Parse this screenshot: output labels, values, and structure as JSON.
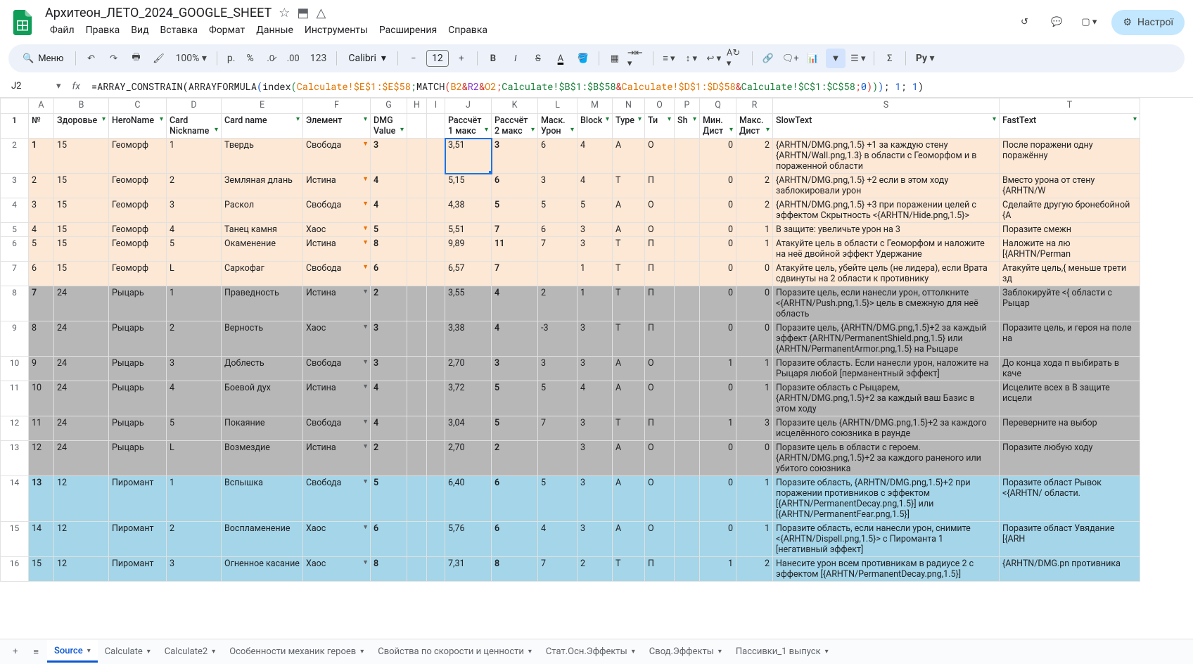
{
  "doc": {
    "title": "Архитеон_ЛЕТО_2024_GOOGLE_SHEET"
  },
  "menubar": [
    "Файл",
    "Правка",
    "Вид",
    "Вставка",
    "Формат",
    "Данные",
    "Инструменты",
    "Расширения",
    "Справка"
  ],
  "header_right": {
    "settings": "Настрої"
  },
  "toolbar": {
    "search_label": "Меню",
    "zoom": "100%",
    "currency": "р.",
    "percent": "%",
    "digits": "123",
    "font": "Calibri",
    "fontsize": "12"
  },
  "namebox": "J2",
  "formula": {
    "parts": [
      {
        "t": "=",
        "c": "fn-black"
      },
      {
        "t": "ARRAY_CONSTRAIN",
        "c": "fn-black"
      },
      {
        "t": "(",
        "c": "fn-black"
      },
      {
        "t": "ARRAYFORMULA",
        "c": "fn-black"
      },
      {
        "t": "(",
        "c": "fn-blue"
      },
      {
        "t": "index",
        "c": "fn-black"
      },
      {
        "t": "(",
        "c": "fn-green"
      },
      {
        "t": "Calculate!$E$1:$E$58",
        "c": "fn-orange"
      },
      {
        "t": ";",
        "c": "fn-green"
      },
      {
        "t": "MATCH",
        "c": "fn-black"
      },
      {
        "t": "(",
        "c": "fn-red"
      },
      {
        "t": "B2",
        "c": "fn-orange"
      },
      {
        "t": "&",
        "c": "fn-red"
      },
      {
        "t": "R2",
        "c": "fn-purple"
      },
      {
        "t": "&",
        "c": "fn-red"
      },
      {
        "t": "O2",
        "c": "fn-orange"
      },
      {
        "t": ";",
        "c": "fn-red"
      },
      {
        "t": "Calculate!$B$1:$B$58",
        "c": "fn-green"
      },
      {
        "t": "&",
        "c": "fn-red"
      },
      {
        "t": "Calculate!$D$1:$D$58",
        "c": "fn-orange"
      },
      {
        "t": "&",
        "c": "fn-red"
      },
      {
        "t": "Calculate!$C$1:$C$58",
        "c": "fn-green"
      },
      {
        "t": ";",
        "c": "fn-red"
      },
      {
        "t": "0",
        "c": "fn-blue"
      },
      {
        "t": ")",
        "c": "fn-red"
      },
      {
        "t": ")",
        "c": "fn-green"
      },
      {
        "t": ")",
        "c": "fn-blue"
      },
      {
        "t": "; ",
        "c": "fn-black"
      },
      {
        "t": "1",
        "c": "fn-blue"
      },
      {
        "t": "; ",
        "c": "fn-black"
      },
      {
        "t": "1",
        "c": "fn-blue"
      },
      {
        "t": ")",
        "c": "fn-black"
      }
    ]
  },
  "columns": [
    "A",
    "B",
    "C",
    "D",
    "E",
    "F",
    "G",
    "H",
    "I",
    "J",
    "K",
    "L",
    "M",
    "N",
    "O",
    "P",
    "Q",
    "R",
    "S",
    "T"
  ],
  "headers": {
    "A": "№",
    "B": "Здоровье",
    "C": "HeroName",
    "D": "Card Nickname",
    "E": "Card name",
    "F": "Элемент",
    "G": "DMG Value",
    "H": "",
    "I": "",
    "J": "Рассчёт 1 макс",
    "K": "Рассчёт 2 макс",
    "L": "Маск. Урон",
    "M": "Block",
    "N": "Type",
    "O": "Ти",
    "P": "Sh",
    "Q": "Мин. Дист",
    "R": "Макс. Дист",
    "S": "SlowText",
    "T": "FastText"
  },
  "rows": [
    {
      "n": "1",
      "bg": "bg-cream",
      "bold": true,
      "A": "1",
      "B": "15",
      "C": "Геоморф",
      "D": "1",
      "E": "Твердь",
      "F": "Свобода",
      "Fdd": "o",
      "G": "3",
      "J": "3,51",
      "K": "3",
      "L": "6",
      "M": "4",
      "N": "А",
      "O": "О",
      "Q": "0",
      "R": "2",
      "S": "{ARHTN/DMG.png,1.5} +1 за каждую стену {ARHTN/Wall.png,1.3} в области с Геоморфом и в пораженной области",
      "T": "После поражени одну поражённу"
    },
    {
      "n": "2",
      "bg": "bg-cream",
      "A": "2",
      "B": "15",
      "C": "Геоморф",
      "D": "2",
      "E": "Земляная длань",
      "F": "Истина",
      "Fdd": "o",
      "G": "4",
      "J": "5,15",
      "K": "6",
      "L": "3",
      "M": "4",
      "N": "Т",
      "O": "П",
      "Q": "0",
      "R": "2",
      "S": "{ARHTN/DMG.png,1.5} +2 если в этом ходу заблокировали урон",
      "T": "Вместо урона от стену {ARHTN/W"
    },
    {
      "n": "3",
      "bg": "bg-cream",
      "A": "3",
      "B": "15",
      "C": "Геоморф",
      "D": "3",
      "E": "Раскол",
      "F": "Свобода",
      "Fdd": "o",
      "G": "4",
      "J": "4,38",
      "K": "5",
      "L": "5",
      "M": "5",
      "N": "А",
      "O": "О",
      "Q": "0",
      "R": "2",
      "S": "{ARHTN/DMG.png,1.5} +3 при поражении целей с эффектом Скрытность <{ARHTN/Hide.png,1.5}>",
      "T": "Сделайте другую бронебойной {А"
    },
    {
      "n": "4",
      "bg": "bg-cream",
      "A": "4",
      "B": "15",
      "C": "Геоморф",
      "D": "4",
      "E": "Танец камня",
      "F": "Хаос",
      "Fdd": "o",
      "G": "5",
      "J": "5,51",
      "K": "7",
      "L": "6",
      "M": "3",
      "N": "А",
      "O": "О",
      "Q": "0",
      "R": "1",
      "S": "В защите: увеличьте урон на 3",
      "T": "Поразите смежн"
    },
    {
      "n": "5",
      "bg": "bg-cream",
      "A": "5",
      "B": "15",
      "C": "Геоморф",
      "D": "5",
      "E": "Окаменение",
      "F": "Истина",
      "Fdd": "o",
      "G": "8",
      "J": "9,89",
      "K": "11",
      "L": "7",
      "M": "3",
      "N": "Т",
      "O": "П",
      "Q": "0",
      "R": "1",
      "S": "Атакуйте цель в области с Геоморфом и наложите на неё двойной эффект Удержание",
      "T": "Наложите на лю [{ARHTN/Perman"
    },
    {
      "n": "6",
      "bg": "bg-cream",
      "A": "6",
      "B": "15",
      "C": "Геоморф",
      "D": "L",
      "E": "Саркофаг",
      "F": "Свобода",
      "Fdd": "o",
      "G": "6",
      "J": "6,57",
      "K": "7",
      "L": "",
      "M": "1",
      "N": "Т",
      "O": "П",
      "Q": "0",
      "R": "0",
      "S": "Атакуйте цель, убейте цель (не лидера), если Врата сдвинуты на 2 области к противнику",
      "T": "Атакуйте цель,{ меньше трети зд"
    },
    {
      "n": "7",
      "bg": "bg-gray",
      "bold": true,
      "A": "7",
      "B": "24",
      "C": "Рыцарь",
      "D": "1",
      "E": "Праведность",
      "F": "Истина",
      "Fdd": "b",
      "G": "2",
      "J": "3,55",
      "K": "4",
      "L": "2",
      "M": "1",
      "N": "Т",
      "O": "П",
      "Q": "0",
      "R": "0",
      "S": "Поразите цель, если нанесли урон, оттолкните <{ARHTN/Push.png,1.5}> цель в смежную для неё область",
      "T": "Заблокируйте <{ области с Рыцар"
    },
    {
      "n": "8",
      "bg": "bg-gray",
      "A": "8",
      "B": "24",
      "C": "Рыцарь",
      "D": "2",
      "E": "Верность",
      "F": "Хаос",
      "Fdd": "b",
      "G": "3",
      "J": "3,38",
      "K": "4",
      "L": "-3",
      "M": "3",
      "N": "Т",
      "O": "П",
      "Q": "0",
      "R": "0",
      "S": "Поразите цель, {ARHTN/DMG.png,1.5}+2 за каждый эффект {ARHTN/PermanentShield.png,1.5} или {ARHTN/PermanentArmor.png,1.5} на Рыцаре",
      "T": "Поразите цель, и героя на поле на"
    },
    {
      "n": "9",
      "bg": "bg-gray",
      "A": "9",
      "B": "24",
      "C": "Рыцарь",
      "D": "3",
      "E": "Доблесть",
      "F": "Свобода",
      "Fdd": "b",
      "G": "3",
      "J": "2,70",
      "K": "3",
      "L": "3",
      "M": "3",
      "N": "А",
      "O": "О",
      "Q": "1",
      "R": "1",
      "S": "Поразите область. Если нанесли урон, наложите на Рыцаря любой [перманентный эффект]",
      "T": "До конца хода п выбирать в каче"
    },
    {
      "n": "10",
      "bg": "bg-gray",
      "A": "10",
      "B": "24",
      "C": "Рыцарь",
      "D": "4",
      "E": "Боевой дух",
      "F": "Истина",
      "Fdd": "b",
      "G": "4",
      "J": "3,72",
      "K": "5",
      "L": "5",
      "M": "4",
      "N": "А",
      "O": "О",
      "Q": "0",
      "R": "1",
      "S": "Поразите область с Рыцарем, {ARHTN/DMG.png,1.5}+2 за каждый ваш Базис в этом ходу",
      "T": "Исцелите всех в В защите исцели"
    },
    {
      "n": "11",
      "bg": "bg-gray",
      "A": "11",
      "B": "24",
      "C": "Рыцарь",
      "D": "5",
      "E": "Покаяние",
      "F": "Свобода",
      "Fdd": "b",
      "G": "4",
      "J": "3,04",
      "K": "5",
      "L": "7",
      "M": "3",
      "N": "Т",
      "O": "П",
      "Q": "1",
      "R": "3",
      "S": "Поразите цель {ARHTN/DMG.png,1.5}+2 за каждого исцелённого союзника в раунде",
      "T": "Переверните на выбор"
    },
    {
      "n": "12",
      "bg": "bg-gray",
      "A": "12",
      "B": "24",
      "C": "Рыцарь",
      "D": "L",
      "E": "Возмездие",
      "F": "Истина",
      "Fdd": "b",
      "G": "2",
      "J": "2,70",
      "K": "2",
      "L": "",
      "M": "3",
      "N": "А",
      "O": "О",
      "Q": "0",
      "R": "0",
      "S": "Поразите цель в области с героем. {ARHTN/DMG.png,1.5}+2 за каждого  раненого или убитого союзника",
      "T": "Поразите любую ходу"
    },
    {
      "n": "13",
      "bg": "bg-blue",
      "bold": true,
      "A": "13",
      "B": "12",
      "C": "Пиромант",
      "D": "1",
      "E": "Вспышка",
      "F": "Свобода",
      "Fdd": "b",
      "G": "5",
      "J": "6,40",
      "K": "6",
      "L": "5",
      "M": "3",
      "N": "А",
      "O": "О",
      "Q": "0",
      "R": "1",
      "S": "Поразите область, {ARHTN/DMG.png,1.5}+2 при поражении противников с эффектом [{ARHTN/PermanentDecay.png,1.5}] или [{ARHTN/PermanentFear.png,1.5}]",
      "T": "Поразите област Рывок <{ARHTN/ области."
    },
    {
      "n": "14",
      "bg": "bg-blue",
      "A": "14",
      "B": "12",
      "C": "Пиромант",
      "D": "2",
      "E": "Воспламенение",
      "F": "Хаос",
      "Fdd": "b",
      "G": "6",
      "J": "5,76",
      "K": "6",
      "L": "4",
      "M": "3",
      "N": "А",
      "O": "О",
      "Q": "0",
      "R": "1",
      "S": "Поразите область, если нанесли урон, снимите <{ARHTN/Dispell.png,1.5}> с Пироманта 1 [негативный эффект]",
      "T": "Поразите област Увядание [{ARН"
    },
    {
      "n": "15",
      "bg": "bg-blue",
      "A": "15",
      "B": "12",
      "C": "Пиромант",
      "D": "3",
      "E": "Огненное касание",
      "F": "Хаос",
      "Fdd": "b",
      "G": "8",
      "J": "7,31",
      "K": "8",
      "L": "7",
      "M": "2",
      "N": "Т",
      "O": "П",
      "Q": "1",
      "R": "2",
      "S": "Нанесите урон всем противникам в радиусе 2 с эффектом [{ARHTN/PermanentDecay.png,1.5}]",
      "T": "{ARHTN/DMG.pn противника"
    }
  ],
  "tabs": [
    "Source",
    "Calculate",
    "Calculate2",
    "Особенности механик героев",
    "Свойства по скорости и ценности",
    "Стат.Осн.Эффекты",
    "Свод.Эффекты",
    "Пассивки_1 выпуск"
  ],
  "active_tab": 0
}
